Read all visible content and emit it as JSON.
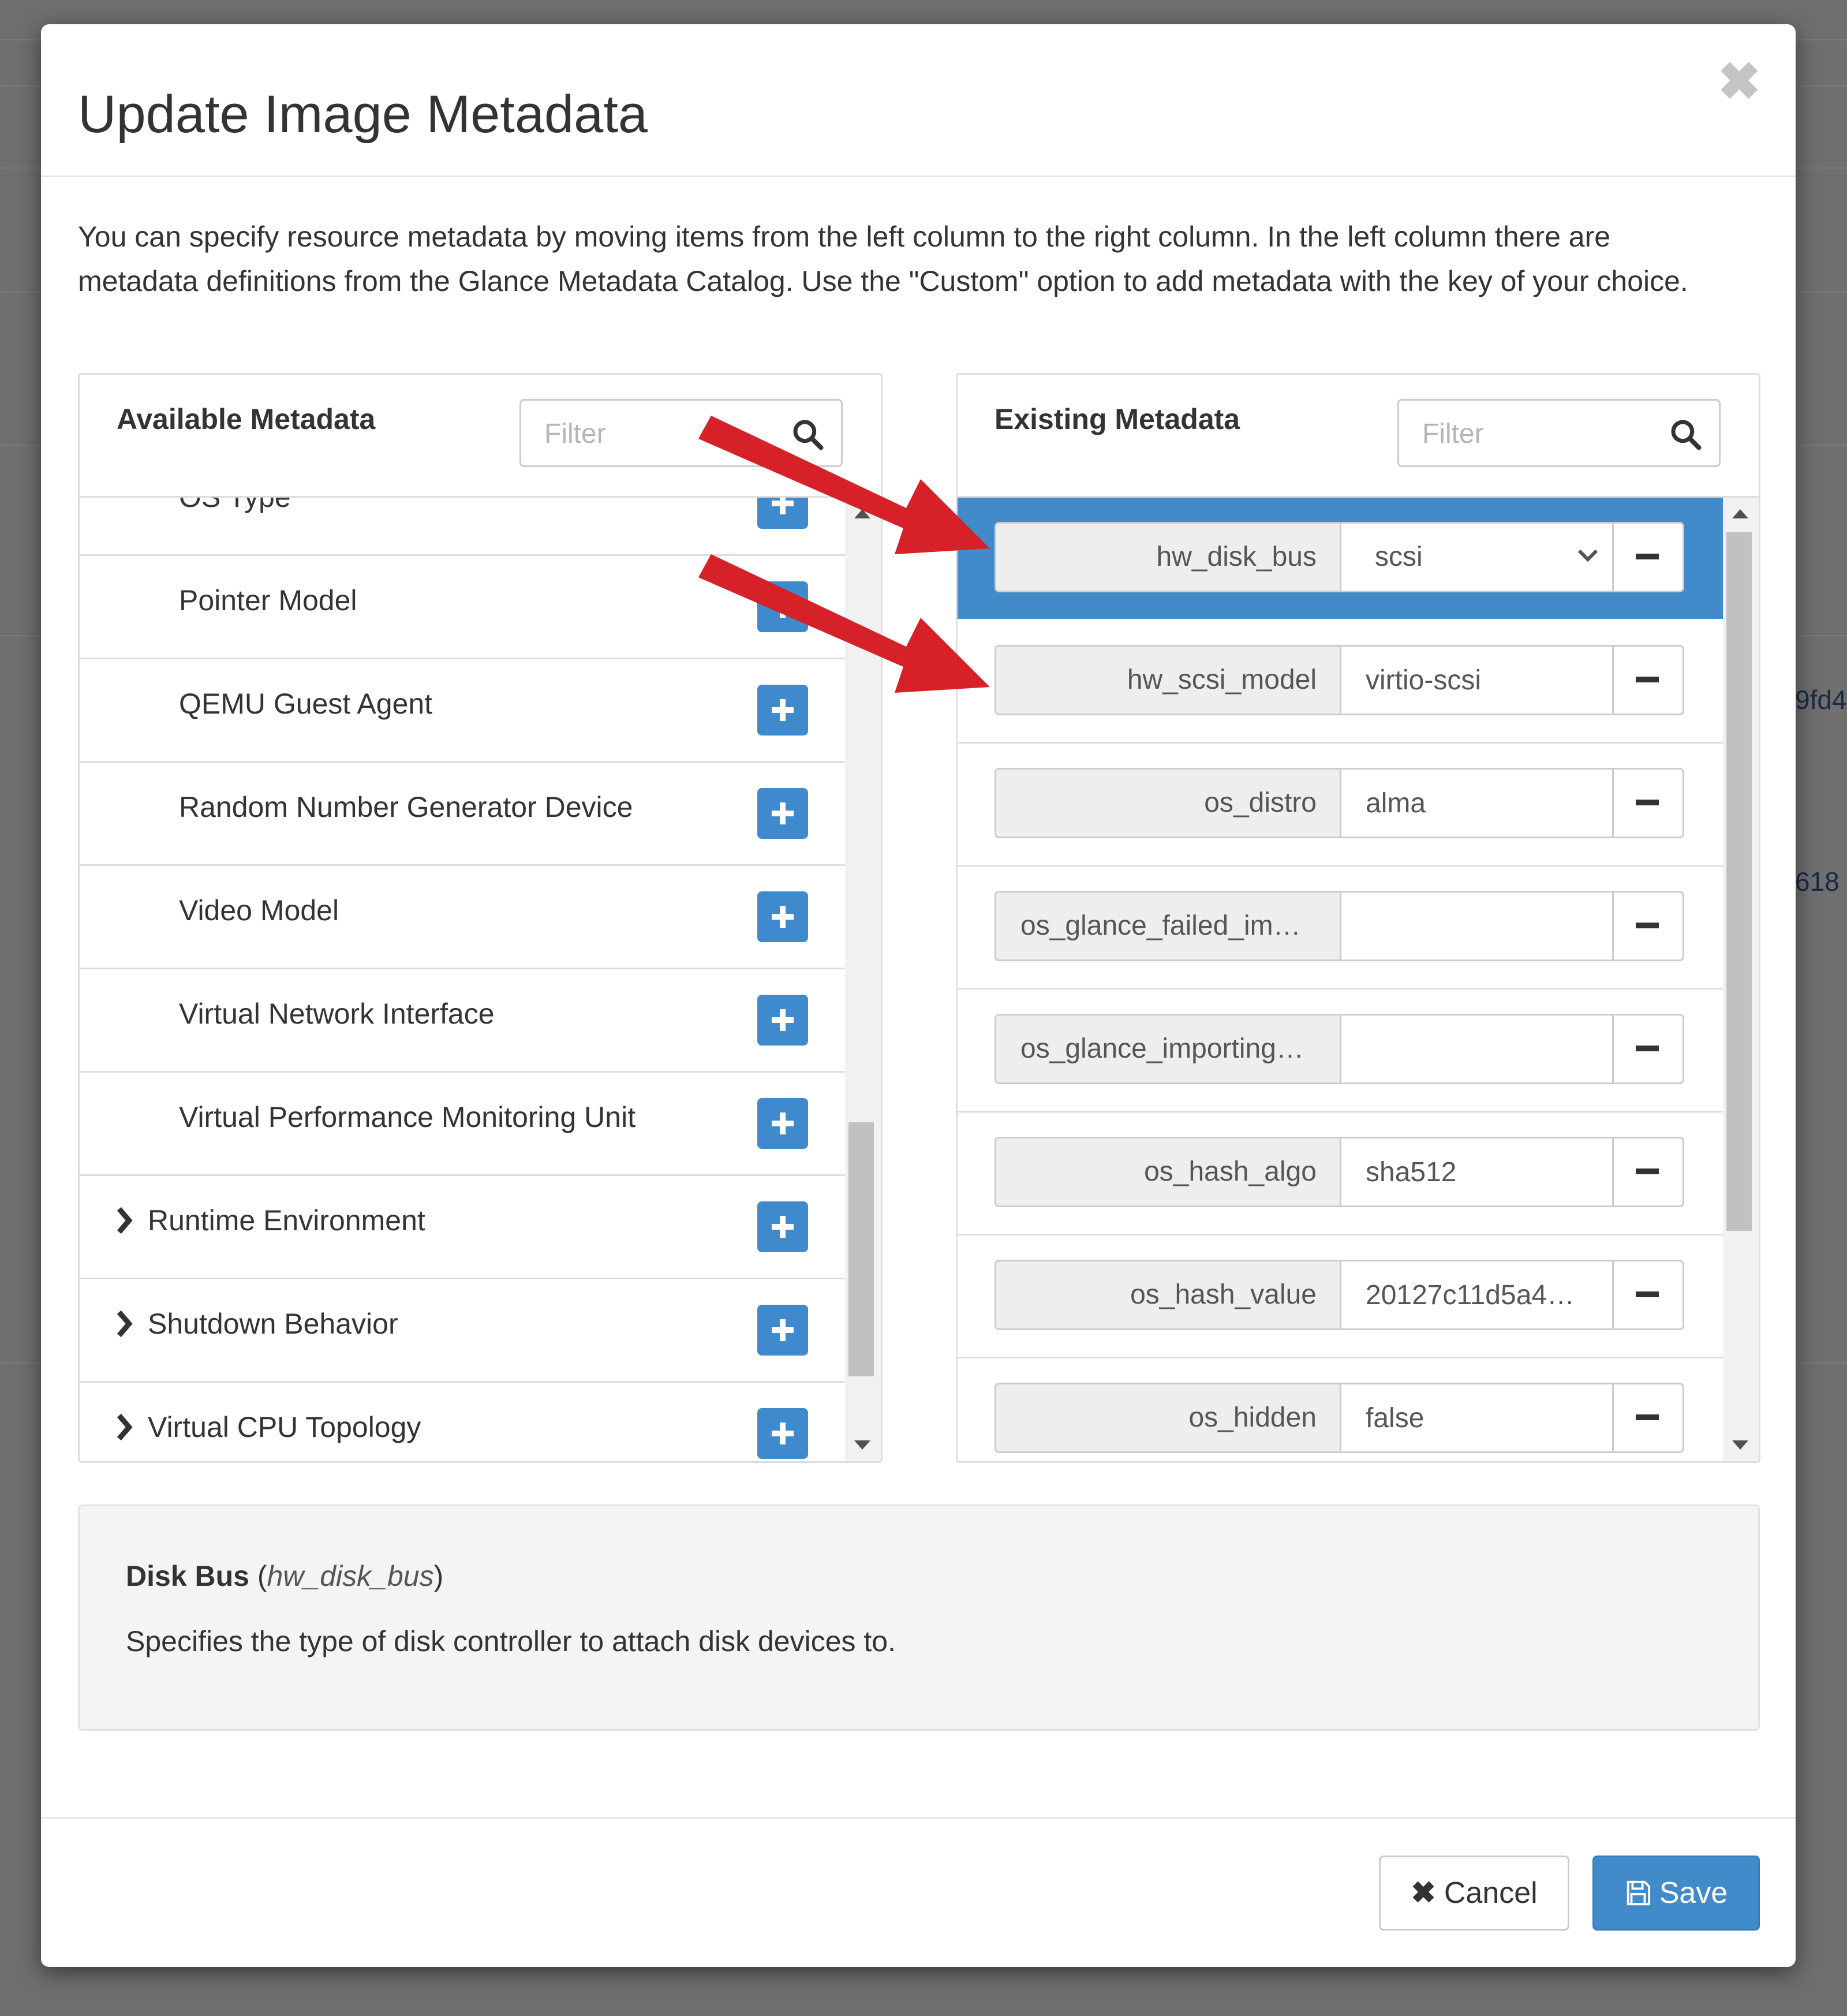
{
  "background": {
    "partial_text": [
      "9fd4",
      "618"
    ]
  },
  "modal": {
    "title": "Update Image Metadata",
    "close_icon": "close-icon",
    "intro": "You can specify resource metadata by moving items from the left column to the right column. In the left column there are metadata definitions from the Glance Metadata Catalog. Use the \"Custom\" option to add metadata with the key of your choice."
  },
  "available": {
    "title": "Available Metadata",
    "filter_placeholder": "Filter",
    "filter_value": "",
    "items": [
      {
        "label": "OS Type",
        "kind": "child"
      },
      {
        "label": "Pointer Model",
        "kind": "child"
      },
      {
        "label": "QEMU Guest Agent",
        "kind": "child"
      },
      {
        "label": "Random Number Generator Device",
        "kind": "child"
      },
      {
        "label": "Video Model",
        "kind": "child"
      },
      {
        "label": "Virtual Network Interface",
        "kind": "child"
      },
      {
        "label": "Virtual Performance Monitoring Unit",
        "kind": "child"
      },
      {
        "label": "Runtime Environment",
        "kind": "group"
      },
      {
        "label": "Shutdown Behavior",
        "kind": "group"
      },
      {
        "label": "Virtual CPU Topology",
        "kind": "group"
      }
    ]
  },
  "existing": {
    "title": "Existing Metadata",
    "filter_placeholder": "Filter",
    "filter_value": "",
    "items": [
      {
        "key": "hw_disk_bus",
        "value": "scsi",
        "type": "select",
        "active": true
      },
      {
        "key": "hw_scsi_model",
        "value": "virtio-scsi",
        "type": "text"
      },
      {
        "key": "os_distro",
        "value": "alma",
        "type": "text"
      },
      {
        "key": "os_glance_failed_im…",
        "value": "",
        "type": "text",
        "truncated": true
      },
      {
        "key": "os_glance_importing…",
        "value": "",
        "type": "text",
        "truncated": true
      },
      {
        "key": "os_hash_algo",
        "value": "sha512",
        "type": "text"
      },
      {
        "key": "os_hash_value",
        "value": "20127c11d5a4…",
        "type": "text"
      },
      {
        "key": "os_hidden",
        "value": "false",
        "type": "text"
      }
    ]
  },
  "description": {
    "name": "Disk Bus",
    "key": "hw_disk_bus",
    "text": "Specifies the type of disk controller to attach disk devices to."
  },
  "footer": {
    "cancel_label": "Cancel",
    "save_label": "Save"
  },
  "colors": {
    "primary": "#428bca",
    "annotation_arrow": "#d62128"
  }
}
